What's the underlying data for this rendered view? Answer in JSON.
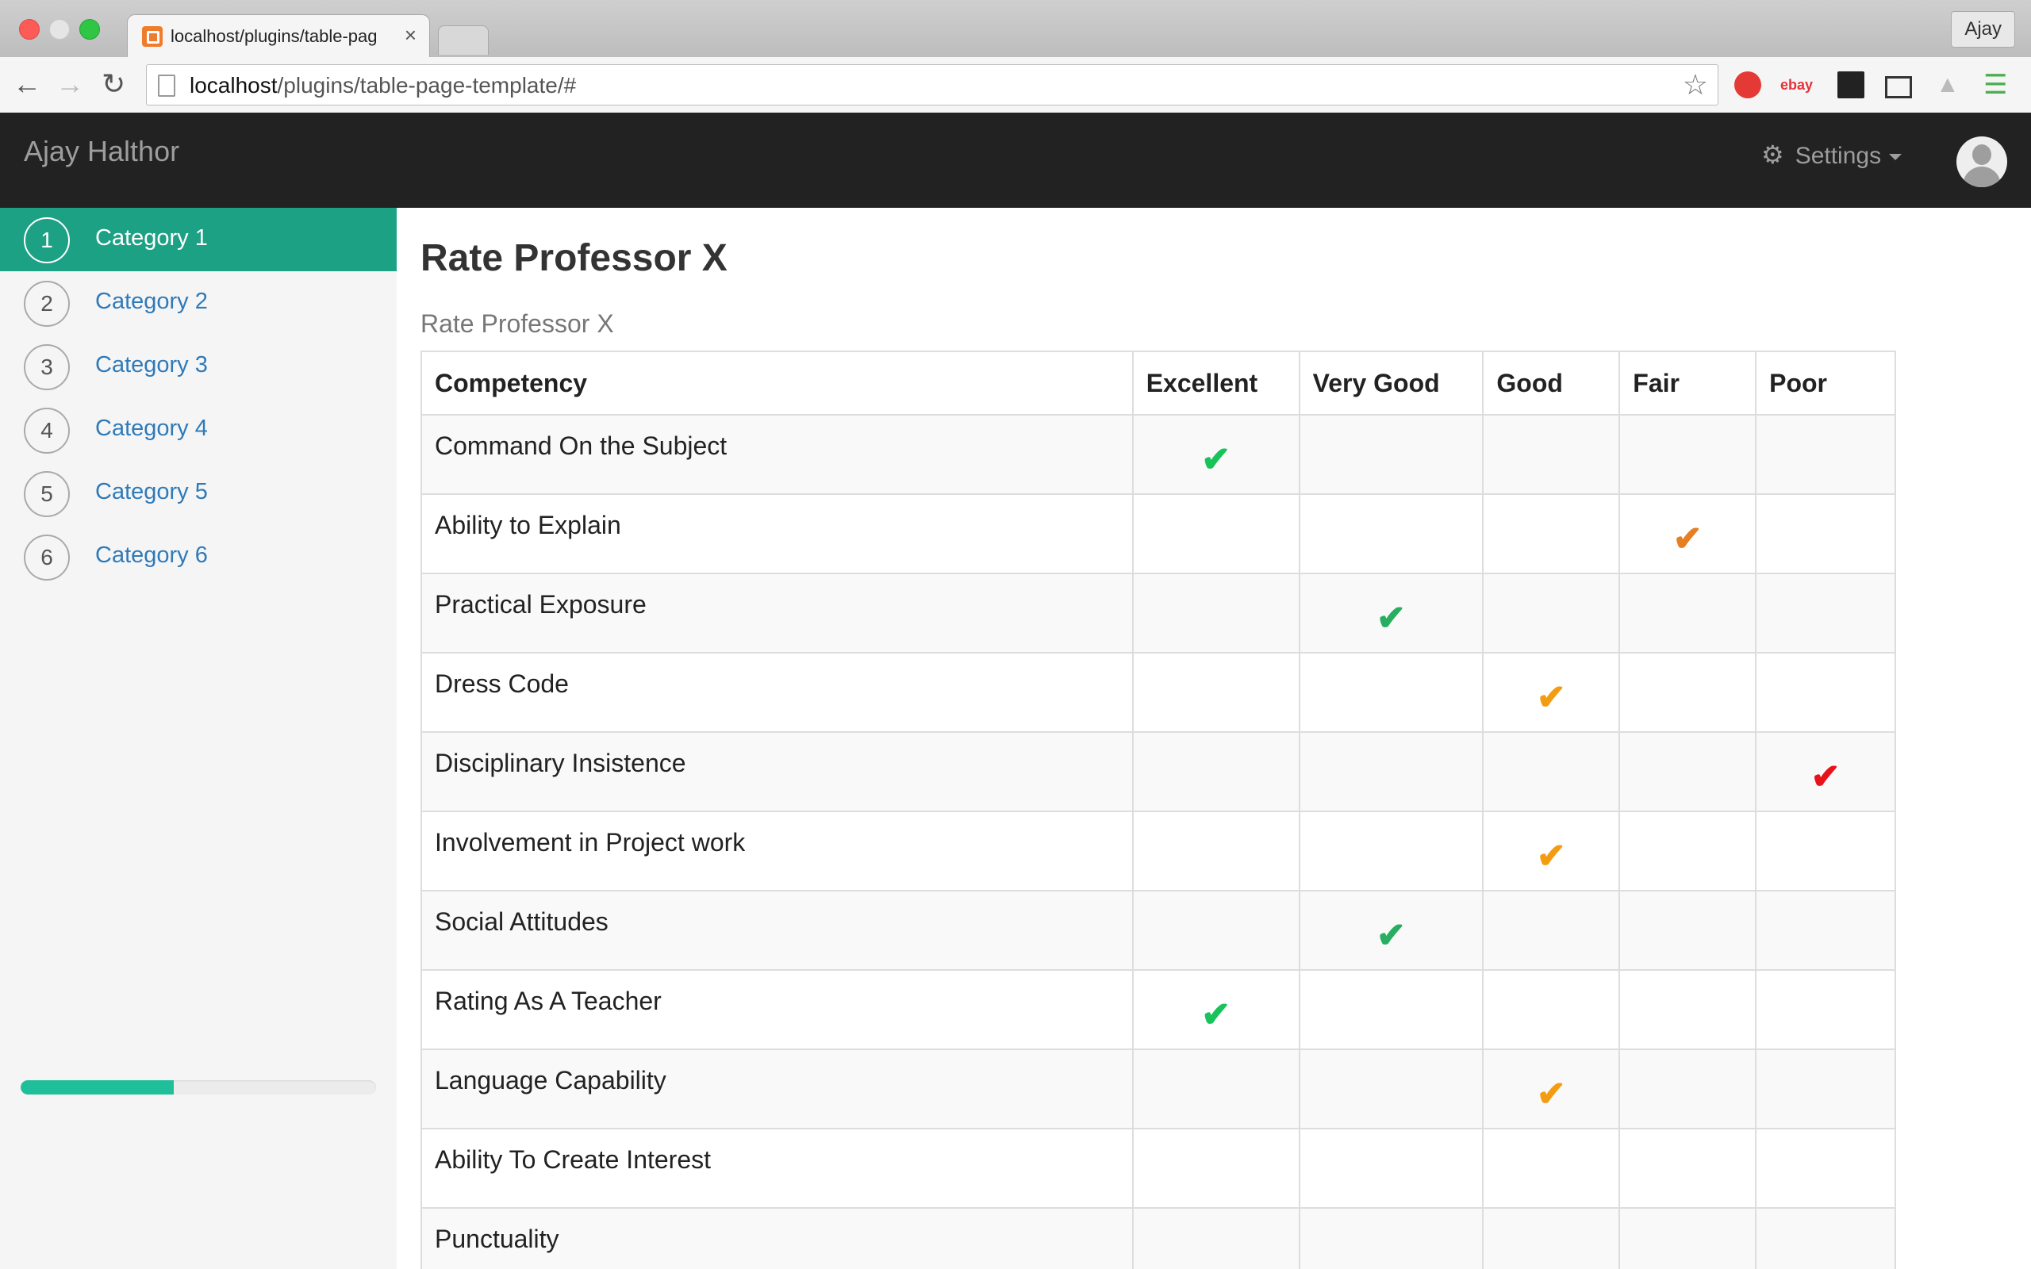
{
  "browser": {
    "tab_title": "localhost/plugins/table-pag",
    "tab_close": "×",
    "profile": "Ajay",
    "url_host": "localhost",
    "url_path": "/plugins/table-page-template/#",
    "ext_ebay": "ebay"
  },
  "app": {
    "brand": "Ajay Halthor",
    "settings_label": "Settings",
    "settings_icon": "⚙"
  },
  "sidebar": {
    "items": [
      {
        "num": "1",
        "label": "Category 1",
        "active": true
      },
      {
        "num": "2",
        "label": "Category 2",
        "active": false
      },
      {
        "num": "3",
        "label": "Category 3",
        "active": false
      },
      {
        "num": "4",
        "label": "Category 4",
        "active": false
      },
      {
        "num": "5",
        "label": "Category 5",
        "active": false
      },
      {
        "num": "6",
        "label": "Category 6",
        "active": false
      }
    ],
    "progress_fraction": 0.43
  },
  "main": {
    "title": "Rate Professor X",
    "subtitle": "Rate Professor X",
    "columns": [
      "Competency",
      "Excellent",
      "Very Good",
      "Good",
      "Fair",
      "Poor"
    ],
    "rows": [
      {
        "competency": "Command On the Subject",
        "rating": 1,
        "color": "#18c35a"
      },
      {
        "competency": "Ability to Explain",
        "rating": 4,
        "color": "#e67e22"
      },
      {
        "competency": "Practical Exposure",
        "rating": 2,
        "color": "#27ae60"
      },
      {
        "competency": "Dress Code",
        "rating": 3,
        "color": "#f39c12"
      },
      {
        "competency": "Disciplinary Insistence",
        "rating": 5,
        "color": "#e8121b"
      },
      {
        "competency": "Involvement in Project work",
        "rating": 3,
        "color": "#f39c12"
      },
      {
        "competency": "Social Attitudes",
        "rating": 2,
        "color": "#27ae60"
      },
      {
        "competency": "Rating As A Teacher",
        "rating": 1,
        "color": "#18c35a"
      },
      {
        "competency": "Language Capability",
        "rating": 3,
        "color": "#f39c12"
      },
      {
        "competency": "Ability To Create Interest",
        "rating": 0,
        "color": ""
      },
      {
        "competency": "Punctuality",
        "rating": 0,
        "color": ""
      }
    ],
    "check_glyph": "✔"
  },
  "colors": {
    "accent": "#1da185",
    "progress": "#1fbf9a",
    "navbar": "#222222",
    "link": "#2f7ab9"
  }
}
